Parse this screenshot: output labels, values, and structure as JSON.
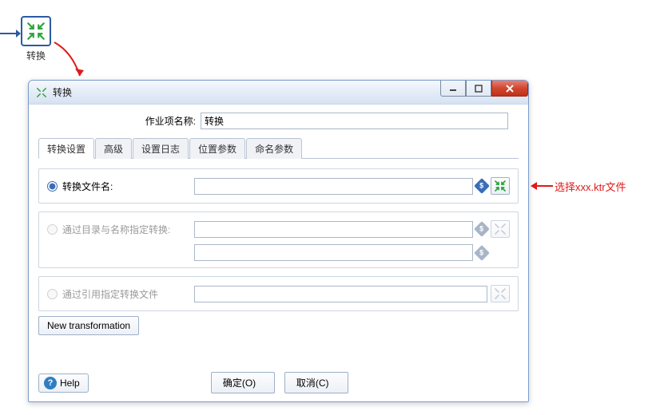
{
  "top_icon_label": "转换",
  "dialog": {
    "title": "转换",
    "name_label": "作业项名称:",
    "name_value": "转换",
    "tabs": [
      "转换设置",
      "高级",
      "设置日志",
      "位置参数",
      "命名参数"
    ],
    "radio_filename": "转换文件名:",
    "radio_directory": "通过目录与名称指定转换:",
    "radio_reference": "通过引用指定转换文件",
    "new_transformation": "New transformation",
    "diamond_glyph": "$",
    "ok": "确定(O)",
    "cancel": "取消(C)",
    "help": "Help"
  },
  "callout": "选择xxx.ktr文件"
}
